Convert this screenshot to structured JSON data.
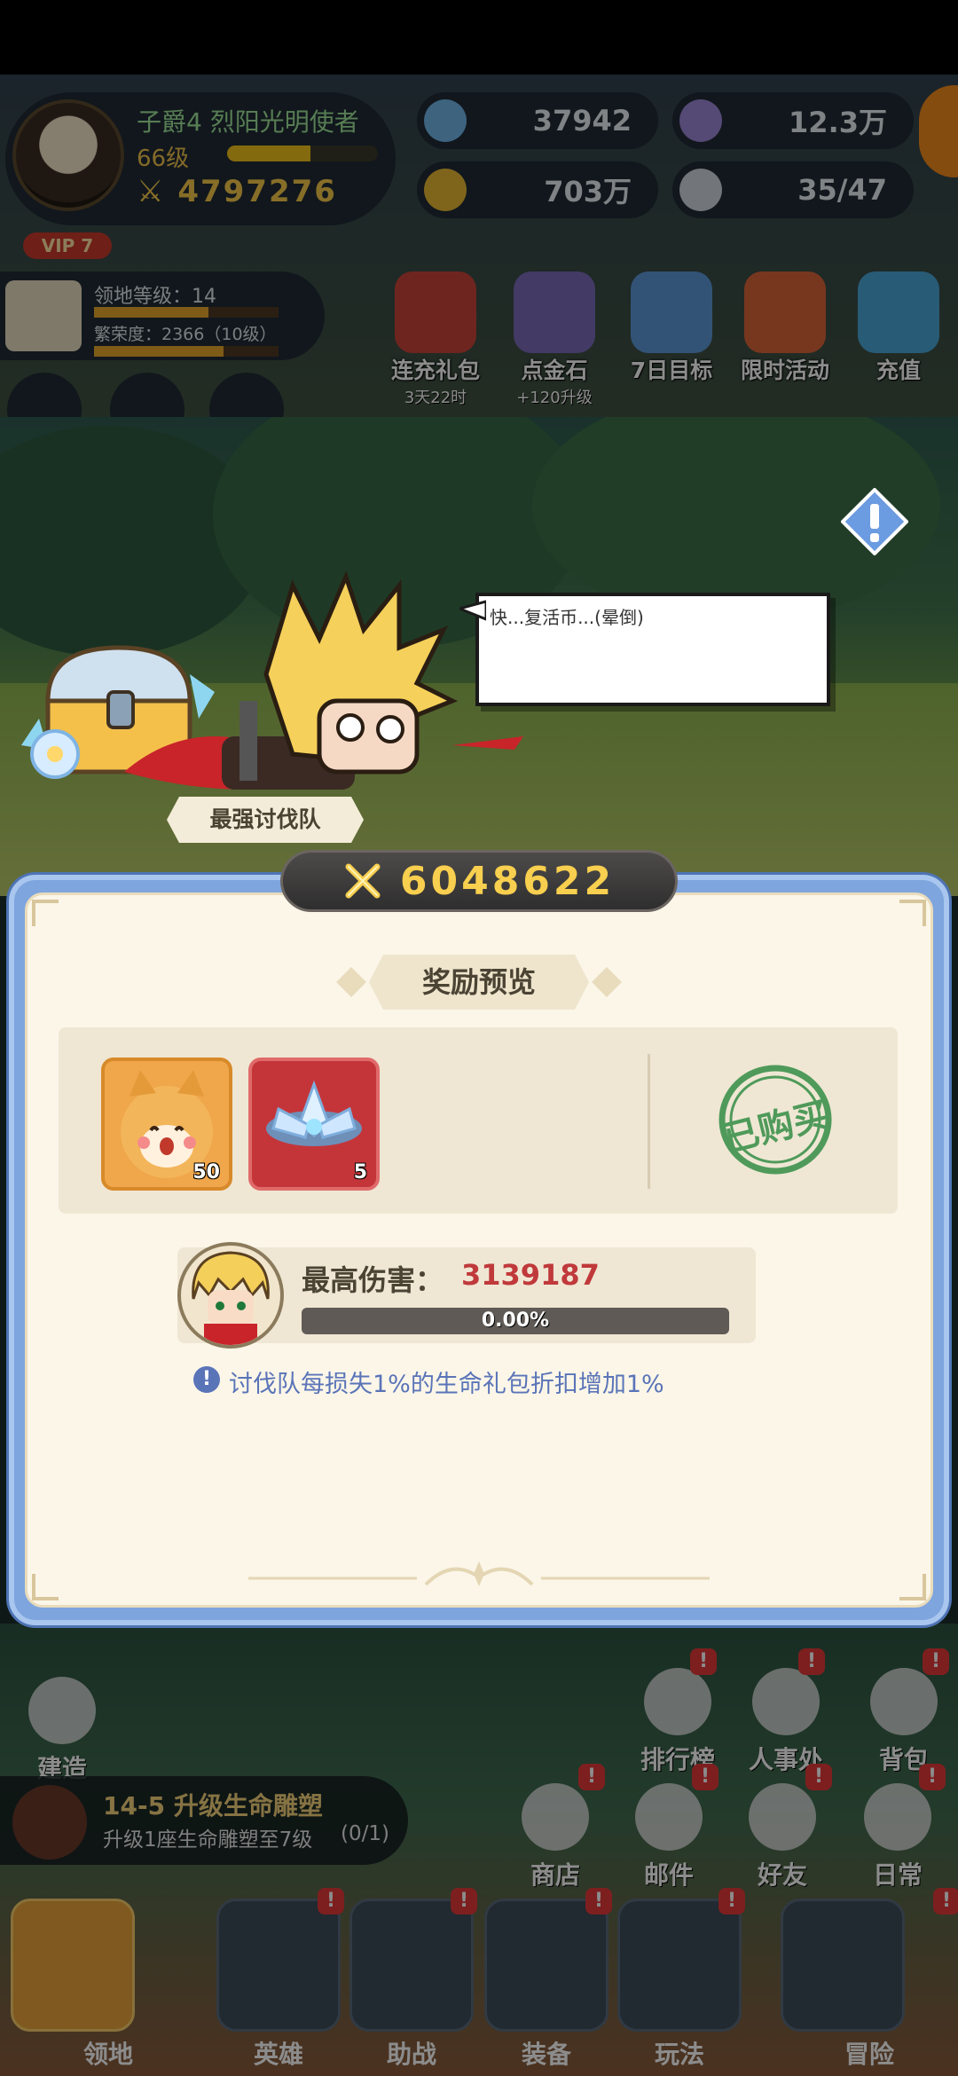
{
  "player": {
    "name": "子爵4 烈阳光明使者",
    "level": "66级",
    "exp_fraction": 0.55,
    "power": "4797276",
    "vip": "VIP 7"
  },
  "resources": {
    "gems": "37942",
    "time_currency": "12.3万",
    "gold": "703万",
    "population": "35/47"
  },
  "territory": {
    "level_text": "领地等级：14",
    "prosperity_text": "繁荣度：2366（10级）",
    "level_fraction": 0.62,
    "prosperity_fraction": 0.7
  },
  "top_buttons": [
    {
      "label": "连充礼包",
      "sub": "3天22时"
    },
    {
      "label": "点金石",
      "sub": "+120升级"
    },
    {
      "label": "7日目标",
      "sub": ""
    },
    {
      "label": "限时活动",
      "sub": ""
    },
    {
      "label": "充值",
      "sub": ""
    }
  ],
  "scene": {
    "speech": "快...复活币...(晕倒)",
    "team_label": "最强讨伐队"
  },
  "modal": {
    "power": "6048622",
    "reward_title": "奖励预览",
    "rewards": [
      {
        "icon": "shiba-dog-icon",
        "qty": "50"
      },
      {
        "icon": "crystal-lotus-icon",
        "qty": "5"
      }
    ],
    "purchased_stamp": "已购买",
    "max_damage_label": "最高伤害：",
    "max_damage_value": "3139187",
    "damage_fraction": 0.0,
    "damage_percent": "0.00%",
    "tip": "讨伐队每损失1%的生命礼包折扣增加1%"
  },
  "base": {
    "build": "建造",
    "ranking": "排行榜",
    "personnel": "人事处",
    "backpack": "背包",
    "shop": "商店",
    "mail": "邮件",
    "friends": "好友",
    "daily": "日常",
    "quest_title": "14-5 升级生命雕塑",
    "quest_desc": "升级1座生命雕塑至7级",
    "quest_progress": "(0/1)"
  },
  "nav_tabs": [
    "领地",
    "英雄",
    "助战",
    "装备",
    "玩法",
    "冒险"
  ],
  "colors": {
    "accent_gold": "#f8cf4e",
    "damage_red": "#c0393b",
    "tip_blue": "#5a74b8",
    "stamp_green": "#4f9a5a"
  }
}
